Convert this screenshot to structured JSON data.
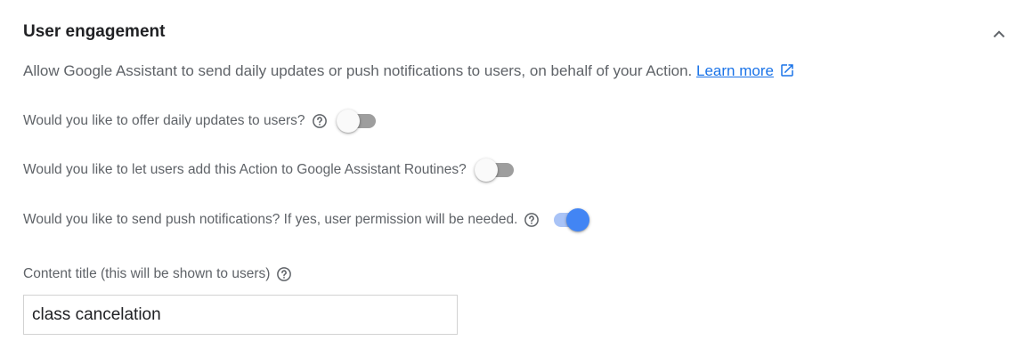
{
  "section": {
    "title": "User engagement",
    "collapse_icon": "chevron-up-icon",
    "description": "Allow Google Assistant to send daily updates or push notifications to users, on behalf of your Action.",
    "learn_more": "Learn more",
    "learn_more_icon": "open-in-new-icon"
  },
  "settings": [
    {
      "label": "Would you like to offer daily updates to users?",
      "has_help": true,
      "enabled": false
    },
    {
      "label": "Would you like to let users add this Action to Google Assistant Routines?",
      "has_help": false,
      "enabled": false
    },
    {
      "label": "Would you like to send push notifications? If yes, user permission will be needed.",
      "has_help": true,
      "enabled": true
    }
  ],
  "content_title": {
    "label": "Content title (this will be shown to users)",
    "value": "class cancelation",
    "placeholder": ""
  },
  "colors": {
    "accent": "#4285f4",
    "link": "#1a73e8",
    "toggle_off_track": "#9e9e9e",
    "toggle_on_track": "#a9c3f6"
  }
}
